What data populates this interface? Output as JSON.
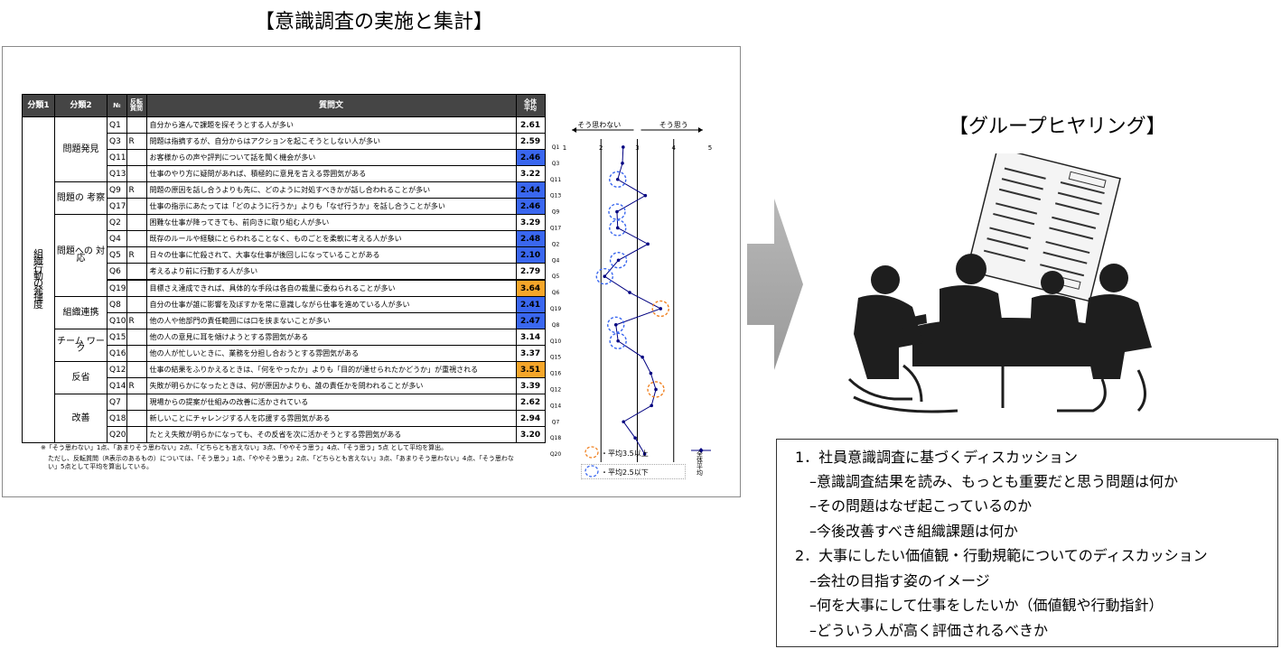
{
  "left_title": "【意識調査の実施と集計】",
  "right_title": "【グループヒヤリング】",
  "table": {
    "headers": [
      "分類1",
      "分類2",
      "№",
      "反転\n質問",
      "質問文",
      "全体\n平均"
    ],
    "category1": "組織行動の発揮度",
    "rows": [
      {
        "id": "Q1",
        "cat2": "問題発見",
        "rev": "",
        "q": "自分から進んで課題を探そうとする人が多い",
        "avg": "2.61",
        "hl": ""
      },
      {
        "id": "Q3",
        "cat2": "問題発見",
        "rev": "R",
        "q": "問題は指摘するが、自分からはアクションを起こそうとしない人が多い",
        "avg": "2.59",
        "hl": ""
      },
      {
        "id": "Q11",
        "cat2": "問題発見",
        "rev": "",
        "q": "お客様からの声や評判について話を聞く機会が多い",
        "avg": "2.46",
        "hl": "blue"
      },
      {
        "id": "Q13",
        "cat2": "問題発見",
        "rev": "",
        "q": "仕事のやり方に疑問があれば、積極的に意見を言える雰囲気がある",
        "avg": "3.22",
        "hl": ""
      },
      {
        "id": "Q9",
        "cat2": "問題の考察",
        "rev": "R",
        "q": "問題の原因を話し合うよりも先に、どのように対処すべきかが話し合われることが多い",
        "avg": "2.44",
        "hl": "blue"
      },
      {
        "id": "Q17",
        "cat2": "問題の考察",
        "rev": "",
        "q": "仕事の指示にあたっては「どのように行うか」よりも「なぜ行うか」を話し合うことが多い",
        "avg": "2.46",
        "hl": "blue"
      },
      {
        "id": "Q2",
        "cat2": "問題への対応",
        "rev": "",
        "q": "困難な仕事が降ってきても、前向きに取り組む人が多い",
        "avg": "3.29",
        "hl": ""
      },
      {
        "id": "Q4",
        "cat2": "問題への対応",
        "rev": "",
        "q": "既存のルールや経験にとらわれることなく、ものごとを柔軟に考える人が多い",
        "avg": "2.48",
        "hl": "blue"
      },
      {
        "id": "Q5",
        "cat2": "問題への対応",
        "rev": "R",
        "q": "日々の仕事に忙殺されて、大事な仕事が後回しになっていることがある",
        "avg": "2.10",
        "hl": "blue"
      },
      {
        "id": "Q6",
        "cat2": "問題への対応",
        "rev": "",
        "q": "考えるより前に行動する人が多い",
        "avg": "2.79",
        "hl": ""
      },
      {
        "id": "Q19",
        "cat2": "問題への対応",
        "rev": "",
        "q": "目標さえ達成できれば、具体的な手段は各自の裁量に委ねられることが多い",
        "avg": "3.64",
        "hl": "orange"
      },
      {
        "id": "Q8",
        "cat2": "組織連携",
        "rev": "",
        "q": "自分の仕事が誰に影響を及ぼすかを常に意識しながら仕事を進めている人が多い",
        "avg": "2.41",
        "hl": "blue"
      },
      {
        "id": "Q10",
        "cat2": "組織連携",
        "rev": "R",
        "q": "他の人や他部門の責任範囲には口を挟まないことが多い",
        "avg": "2.47",
        "hl": "blue"
      },
      {
        "id": "Q15",
        "cat2": "チームワーク",
        "rev": "",
        "q": "他の人の意見に耳を傾けようとする雰囲気がある",
        "avg": "3.14",
        "hl": ""
      },
      {
        "id": "Q16",
        "cat2": "チームワーク",
        "rev": "",
        "q": "他の人が忙しいときに、業務を分担し合おうとする雰囲気がある",
        "avg": "3.37",
        "hl": ""
      },
      {
        "id": "Q12",
        "cat2": "反省",
        "rev": "",
        "q": "仕事の結果をふりかえるときは、「何をやったか」よりも「目的が達せられたかどうか」が重視される",
        "avg": "3.51",
        "hl": "orange"
      },
      {
        "id": "Q14",
        "cat2": "反省",
        "rev": "R",
        "q": "失敗が明らかになったときは、何が原因かよりも、誰の責任かを問われることが多い",
        "avg": "3.39",
        "hl": ""
      },
      {
        "id": "Q7",
        "cat2": "改善",
        "rev": "",
        "q": "現場からの提案が仕組みの改善に活かされている",
        "avg": "2.62",
        "hl": ""
      },
      {
        "id": "Q18",
        "cat2": "改善",
        "rev": "",
        "q": "新しいことにチャレンジする人を応援する雰囲気がある",
        "avg": "2.94",
        "hl": ""
      },
      {
        "id": "Q20",
        "cat2": "改善",
        "rev": "",
        "q": "たとえ失敗が明らかになっても、その反省を次に活かそうとする雰囲気がある",
        "avg": "3.20",
        "hl": ""
      }
    ],
    "groups": [
      {
        "label": "問題発見",
        "span": 4
      },
      {
        "label": "問題の\n考察",
        "span": 2
      },
      {
        "label": "問題への\n対応",
        "span": 5
      },
      {
        "label": "組織連携",
        "span": 2
      },
      {
        "label": "チーム\nワーク",
        "span": 2
      },
      {
        "label": "反省",
        "span": 2
      },
      {
        "label": "改善",
        "span": 3
      }
    ],
    "notes": [
      "※「そう思わない」1点、「あまりそう思わない」2点、「どちらとも言えない」3点、「ややそう思う」4点、「そう思う」5点 として平均を算出。",
      "ただし、反転質問（R表示のあるもの）については、「そう思う」1点、「ややそう思う」2点、「どちらとも言えない」3点、「あまりそう思わない」4点、「そう思わな",
      "い」5点として平均を算出している。"
    ]
  },
  "chart_data": {
    "type": "line",
    "orientation": "horizontal",
    "x_ticks": [
      "1",
      "2",
      "3",
      "4",
      "5"
    ],
    "xlim": [
      1,
      5
    ],
    "direction_left": "そう思わない",
    "direction_right": "そう思う",
    "categories": [
      "Q1",
      "Q3",
      "Q11",
      "Q13",
      "Q9",
      "Q17",
      "Q2",
      "Q4",
      "Q5",
      "Q6",
      "Q19",
      "Q8",
      "Q10",
      "Q15",
      "Q16",
      "Q12",
      "Q14",
      "Q7",
      "Q18",
      "Q20"
    ],
    "series": [
      {
        "name": "全体\n平均",
        "values": [
          2.61,
          2.59,
          2.46,
          3.22,
          2.44,
          2.46,
          3.29,
          2.48,
          2.1,
          2.79,
          3.64,
          2.41,
          2.47,
          3.14,
          3.37,
          3.51,
          3.39,
          2.62,
          2.94,
          3.2
        ]
      }
    ],
    "legend": {
      "high": "・平均3.5以上",
      "low": "・平均2.5以下",
      "series": "全体\n平均"
    },
    "colors": {
      "line": "#000080",
      "high": "#f08020",
      "low": "#3a67ef"
    }
  },
  "discussion": {
    "sections": [
      {
        "title": "1．社員意識調査に基づくディスカッション",
        "items": [
          "–意識調査結果を読み、もっとも重要だと思う問題は何か",
          "–その問題はなぜ起こっているのか",
          "–今後改善すべき組織課題は何か"
        ]
      },
      {
        "title": "2．大事にしたい価値観・行動規範についてのディスカッション",
        "items": [
          "–会社の目指す姿のイメージ",
          "–何を大事にして仕事をしたいか（価値観や行動指針）",
          "–どういう人が高く評価されるべきか"
        ]
      }
    ]
  }
}
